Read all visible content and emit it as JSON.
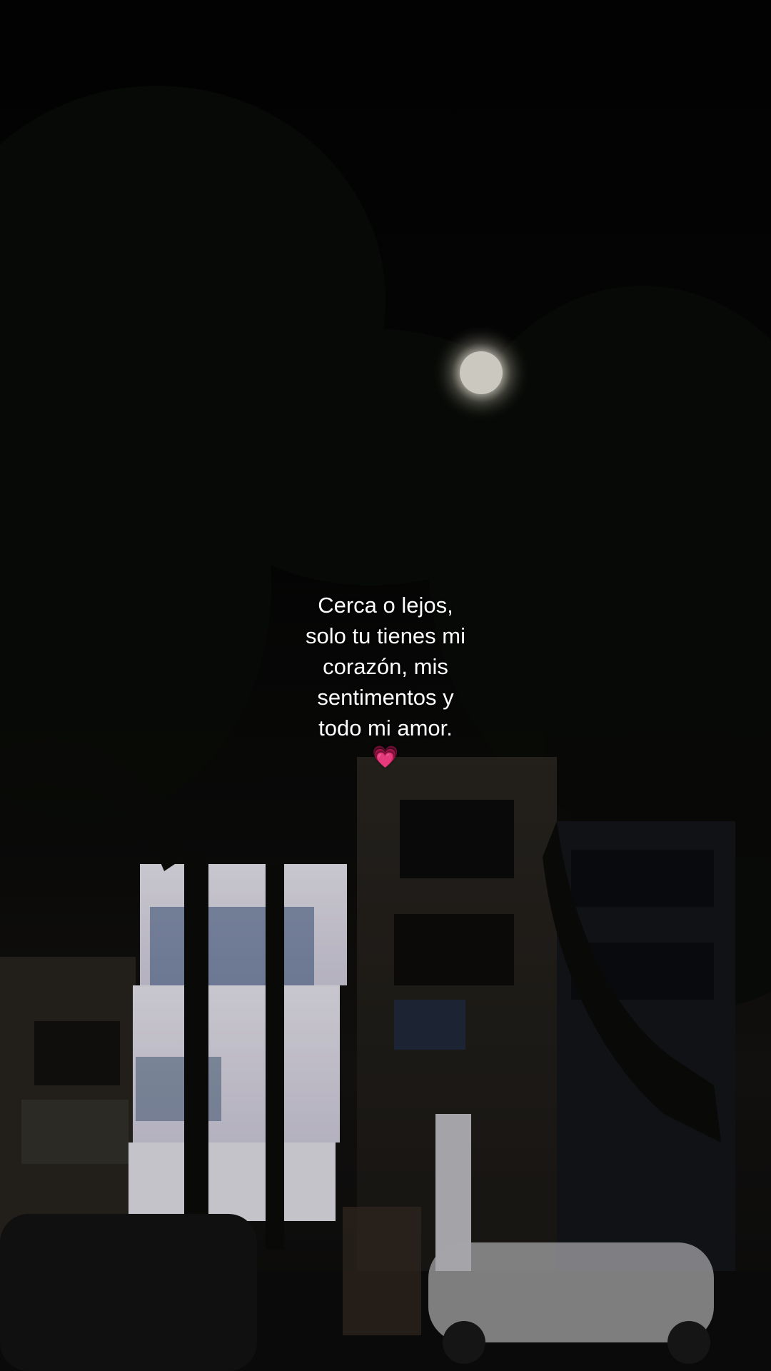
{
  "caption": {
    "lines": [
      "Cerca o lejos,",
      "solo tu tienes mi",
      "corazón, mis",
      "sentimentos y",
      "todo mi amor."
    ],
    "emoji": "💗"
  },
  "colors": {
    "sky": "#050505",
    "moon": "#f2f0e4",
    "caption_text": "#ffffff",
    "heart": "#ff4fa6"
  },
  "icons": {
    "heart": "growing-heart-emoji"
  }
}
